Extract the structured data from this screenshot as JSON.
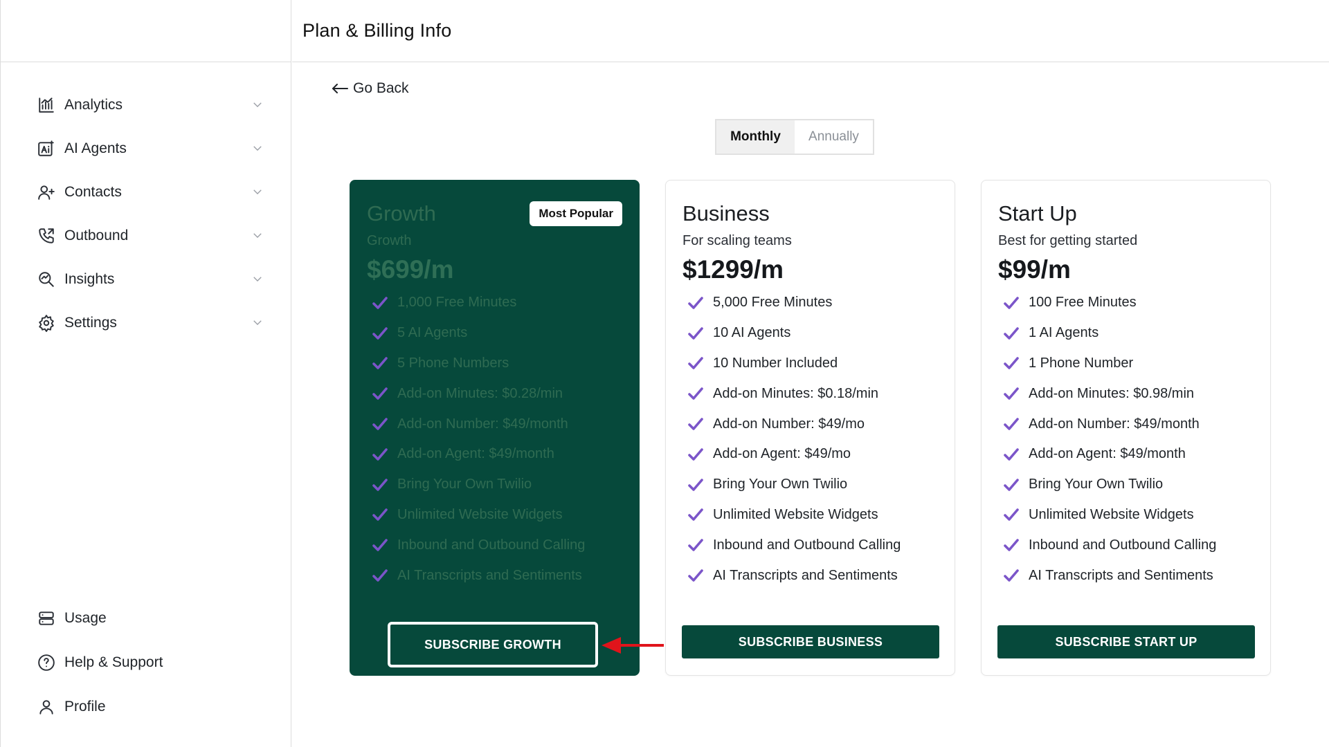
{
  "header": {
    "title": "Plan & Billing Info"
  },
  "sidebar": {
    "items": [
      {
        "label": "Analytics",
        "icon": "analytics-icon"
      },
      {
        "label": "AI Agents",
        "icon": "ai-agents-icon"
      },
      {
        "label": "Contacts",
        "icon": "contacts-icon"
      },
      {
        "label": "Outbound",
        "icon": "phone-icon"
      },
      {
        "label": "Insights",
        "icon": "insights-icon"
      },
      {
        "label": "Settings",
        "icon": "gear-icon"
      }
    ],
    "bottom_items": [
      {
        "label": "Usage",
        "icon": "usage-icon"
      },
      {
        "label": "Help & Support",
        "icon": "help-icon"
      },
      {
        "label": "Profile",
        "icon": "user-icon"
      }
    ]
  },
  "main": {
    "go_back": "Go Back",
    "billing_toggle": {
      "monthly": "Monthly",
      "annually": "Annually",
      "selected": "Monthly"
    },
    "plans": [
      {
        "title": "Growth",
        "subtitle": "Growth",
        "price": "$699/m",
        "badge": "Most Popular",
        "features": [
          "1,000 Free Minutes",
          "5 AI Agents",
          "5 Phone Numbers",
          "Add-on Minutes: $0.28/min",
          "Add-on Number: $49/month",
          "Add-on Agent: $49/month",
          "Bring Your Own Twilio",
          "Unlimited Website Widgets",
          "Inbound and Outbound Calling",
          "AI Transcripts and Sentiments"
        ],
        "button": "SUBSCRIBE GROWTH"
      },
      {
        "title": "Business",
        "subtitle": "For scaling teams",
        "price": "$1299/m",
        "features": [
          "5,000 Free Minutes",
          "10 AI Agents",
          "10 Number Included",
          "Add-on Minutes: $0.18/min",
          "Add-on Number: $49/mo",
          "Add-on Agent: $49/mo",
          "Bring Your Own Twilio",
          "Unlimited Website Widgets",
          "Inbound and Outbound Calling",
          "AI Transcripts and Sentiments"
        ],
        "button": "SUBSCRIBE BUSINESS"
      },
      {
        "title": "Start Up",
        "subtitle": "Best for getting started",
        "price": "$99/m",
        "features": [
          "100 Free Minutes",
          "1 AI Agents",
          "1 Phone Number",
          "Add-on Minutes: $0.98/min",
          "Add-on Number: $49/month",
          "Add-on Agent: $49/month",
          "Bring Your Own Twilio",
          "Unlimited Website Widgets",
          "Inbound and Outbound Calling",
          "AI Transcripts and Sentiments"
        ],
        "button": "SUBSCRIBE START UP"
      }
    ]
  },
  "colors": {
    "brand_green": "#06493b",
    "check_purple": "#7b55c9",
    "annotation_red": "#e0141b"
  }
}
